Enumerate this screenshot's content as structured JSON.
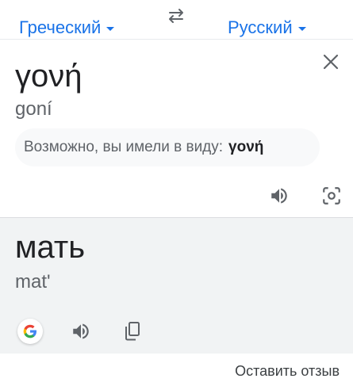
{
  "languages": {
    "source": "Греческий",
    "target": "Русский"
  },
  "source": {
    "text": "γονή",
    "transliteration": "goní",
    "suggestion_prefix": "Возможно, вы имели в виду:",
    "suggestion_word": "γονή"
  },
  "target": {
    "text": "мать",
    "transliteration": "mat'"
  },
  "footer": {
    "feedback": "Оставить отзыв"
  },
  "icons": {
    "swap": "swap-arrows-icon",
    "close": "close-icon",
    "listen": "speaker-icon",
    "camera": "camera-lens-icon",
    "google": "google-logo-icon",
    "copy": "copy-icon"
  },
  "colors": {
    "accent": "#1a73e8",
    "target_background": "#f1f3f4"
  }
}
